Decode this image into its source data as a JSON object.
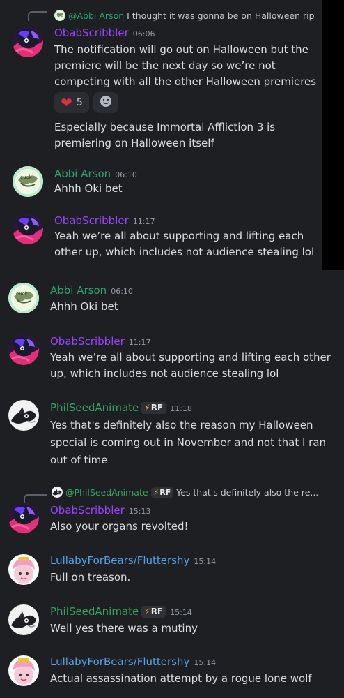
{
  "colors": {
    "obab": "#9b44ff",
    "abbi": "#2fa36b",
    "phil": "#34a55f",
    "lullaby": "#56a3e8",
    "timestamp": "#949ba4",
    "text": "#dbdee1"
  },
  "top": {
    "reply_1": {
      "author": "@Abbi Arson",
      "text": "I thought it was gonna be on Halloween rip"
    },
    "msg_1": {
      "author": "ObabScribbler",
      "time": "06:06",
      "text": "The notification will go out on Halloween but the premiere will be the next day so we’re not competing with all the other Halloween premieres",
      "reactions": [
        {
          "emoji": "heart-icon",
          "count": "5"
        },
        {
          "emoji": "add-reaction-icon",
          "count": ""
        }
      ],
      "followup": "Especially because Immortal Affliction 3 is premiering on Halloween itself"
    },
    "msg_2": {
      "author": "Abbi Arson",
      "time": "06:10",
      "text": "Ahhh Oki bet"
    },
    "msg_3": {
      "author": "ObabScribbler",
      "time": "11:17",
      "text": "Yeah we’re all about supporting and lifting each other up, which includes not audience stealing lol"
    }
  },
  "bottom": {
    "msg_1": {
      "author": "Abbi Arson",
      "time": "06:10",
      "text": "Ahhh Oki bet"
    },
    "msg_2": {
      "author": "ObabScribbler",
      "time": "11:17",
      "text": "Yeah we’re all about supporting and lifting each other up, which includes not audience stealing lol"
    },
    "msg_3": {
      "author": "PhilSeedAnimate",
      "tag": "RF",
      "time": "11:18",
      "text": "Yes that's definitely also the reason my Halloween special is coming out in November and not that I ran out of time"
    },
    "reply_4": {
      "author": "@PhilSeedAnimate",
      "tag": "RF",
      "text": "Yes that's definitely also the re..."
    },
    "msg_4": {
      "author": "ObabScribbler",
      "time": "15:13",
      "text": "Also your organs revolted!"
    },
    "msg_5": {
      "author": "LullabyForBears/Fluttershy",
      "time": "15:14",
      "text": "Full on treason."
    },
    "msg_6": {
      "author": "PhilSeedAnimate",
      "tag": "RF",
      "time": "15:14",
      "text": "Well yes there was a mutiny"
    },
    "msg_7": {
      "author": "LullabyForBears/Fluttershy",
      "time": "15:14",
      "text": "Actual assassination attempt by a rogue lone wolf"
    }
  }
}
